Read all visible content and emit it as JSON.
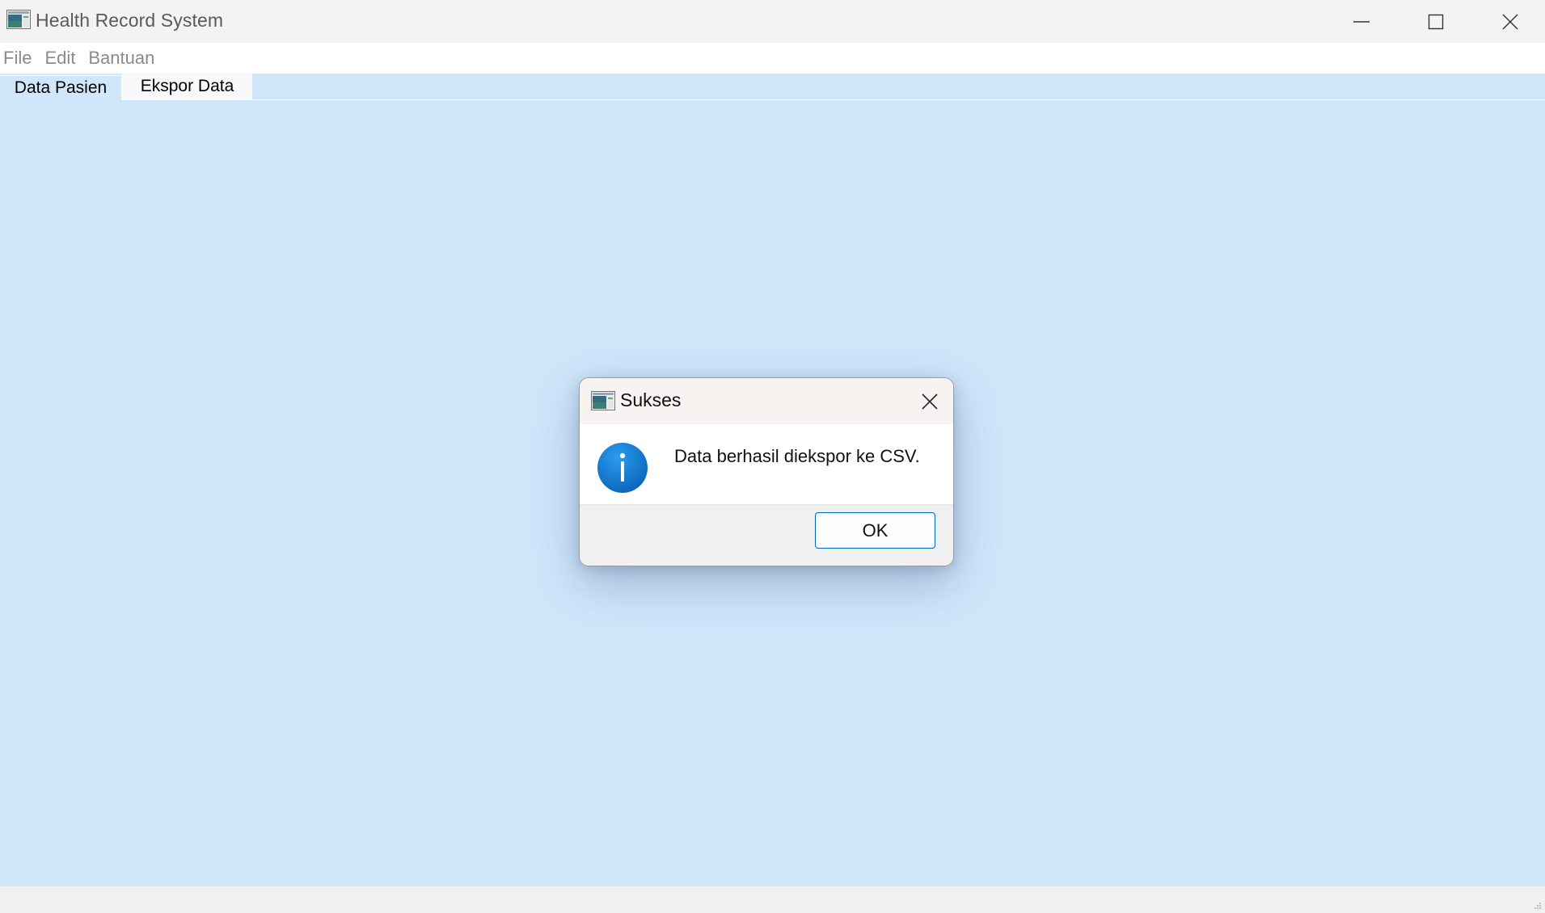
{
  "window": {
    "title": "Health Record System",
    "icon": "app-window-icon"
  },
  "menubar": {
    "items": [
      {
        "label": "File"
      },
      {
        "label": "Edit"
      },
      {
        "label": "Bantuan"
      }
    ]
  },
  "tabs": [
    {
      "label": "Data Pasien",
      "selected": false
    },
    {
      "label": "Ekspor Data",
      "selected": true
    }
  ],
  "dialog": {
    "title": "Sukses",
    "message": "Data berhasil diekspor ke CSV.",
    "icon": "info-icon",
    "ok_label": "OK"
  },
  "colors": {
    "content_background": "#d0e6fb",
    "accent": "#0067c0",
    "info_icon": "#1a86d6"
  }
}
